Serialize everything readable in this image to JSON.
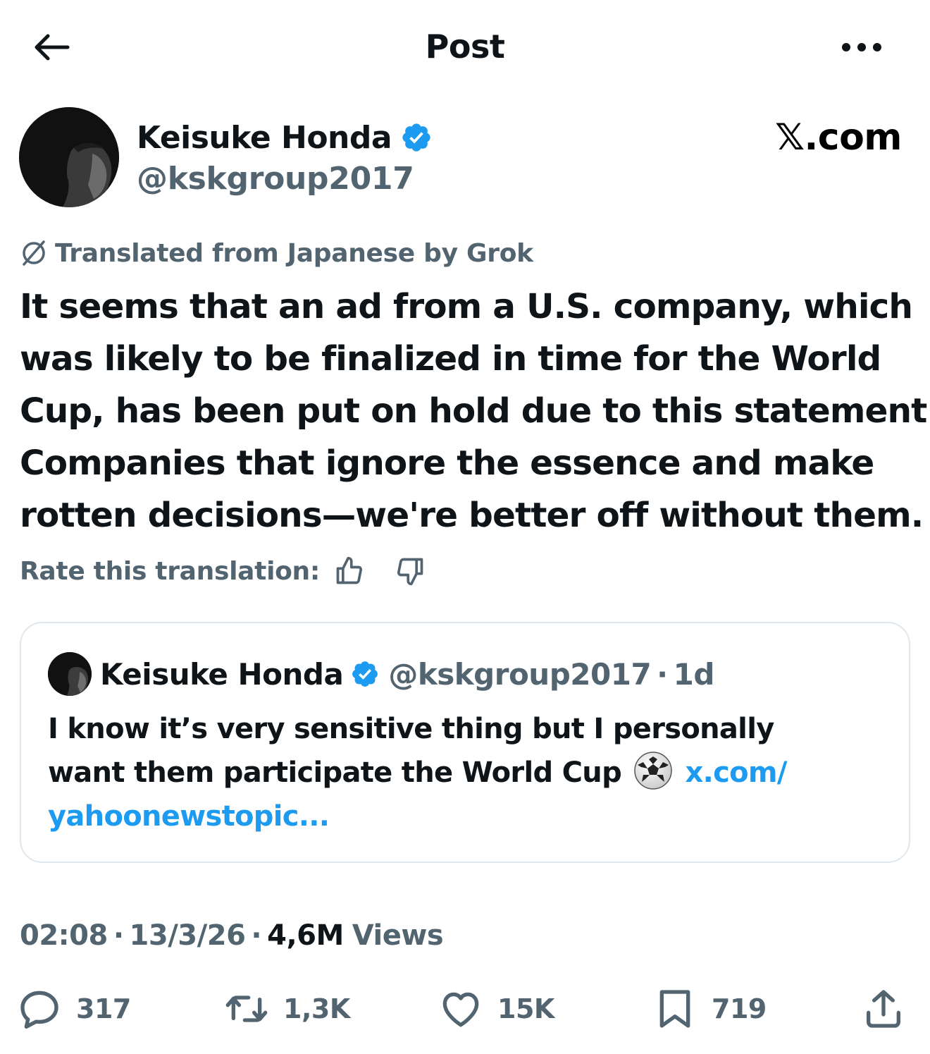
{
  "header": {
    "title": "Post",
    "back_icon": "arrow-left-icon",
    "more_icon": "ellipsis-icon"
  },
  "author": {
    "name": "Keisuke Honda",
    "handle": "@kskgroup2017",
    "verified": true
  },
  "site_mark": "𝕏.com",
  "translation": {
    "label": "Translated from Japanese by Grok",
    "rate_label": "Rate this translation:"
  },
  "post": {
    "lines": [
      "It seems that an ad from a U.S. company, which",
      "was likely to be finalized in time for the World",
      "Cup, has been put on hold due to this statement.",
      "Companies that ignore the essence and make",
      "rotten decisions—we're better off without them."
    ]
  },
  "quote": {
    "name": "Keisuke Honda",
    "handle": "@kskgroup2017",
    "separator": "·",
    "time": "1d",
    "line1": "I know it’s very sensitive thing but I personally",
    "line2_text": "want them participate the World Cup",
    "link_part1": "x.com/",
    "link_part2": "yahoonewstopic..."
  },
  "meta": {
    "time": "02:08",
    "dot": "·",
    "date": "13/3/26",
    "views_count": "4,6M",
    "views_label": "Views"
  },
  "actions": {
    "replies": "317",
    "reposts": "1,3K",
    "likes": "15K",
    "bookmarks": "719"
  },
  "colors": {
    "text": "#0f1419",
    "secondary": "#536471",
    "link": "#1d9bf0",
    "verified": "#1d9bf0",
    "border": "#e1e8ed"
  }
}
